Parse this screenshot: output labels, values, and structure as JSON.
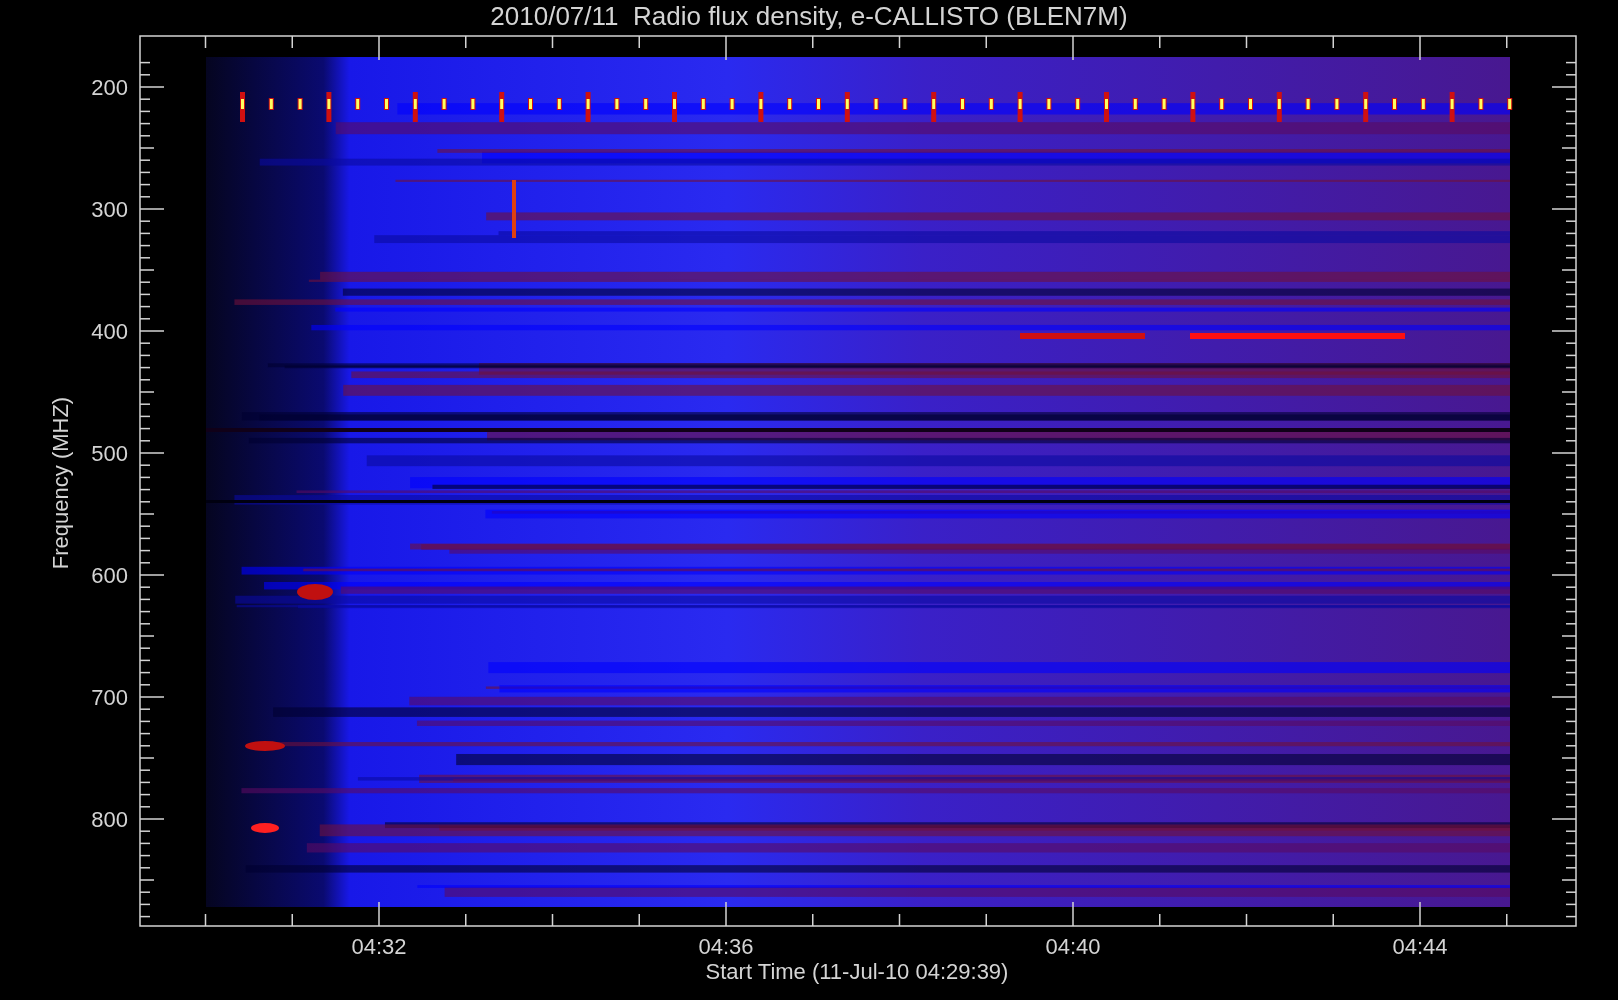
{
  "title": "2010/07/11  Radio flux density, e-CALLISTO (BLEN7M)",
  "y_axis": {
    "label": "Frequency (MHZ)",
    "ticks": [
      "200",
      "300",
      "400",
      "500",
      "600",
      "700",
      "800"
    ]
  },
  "x_axis": {
    "label": "Start Time (11-Jul-10 04:29:39)",
    "ticks": [
      "04:32",
      "04:36",
      "04:40",
      "04:44"
    ]
  }
}
